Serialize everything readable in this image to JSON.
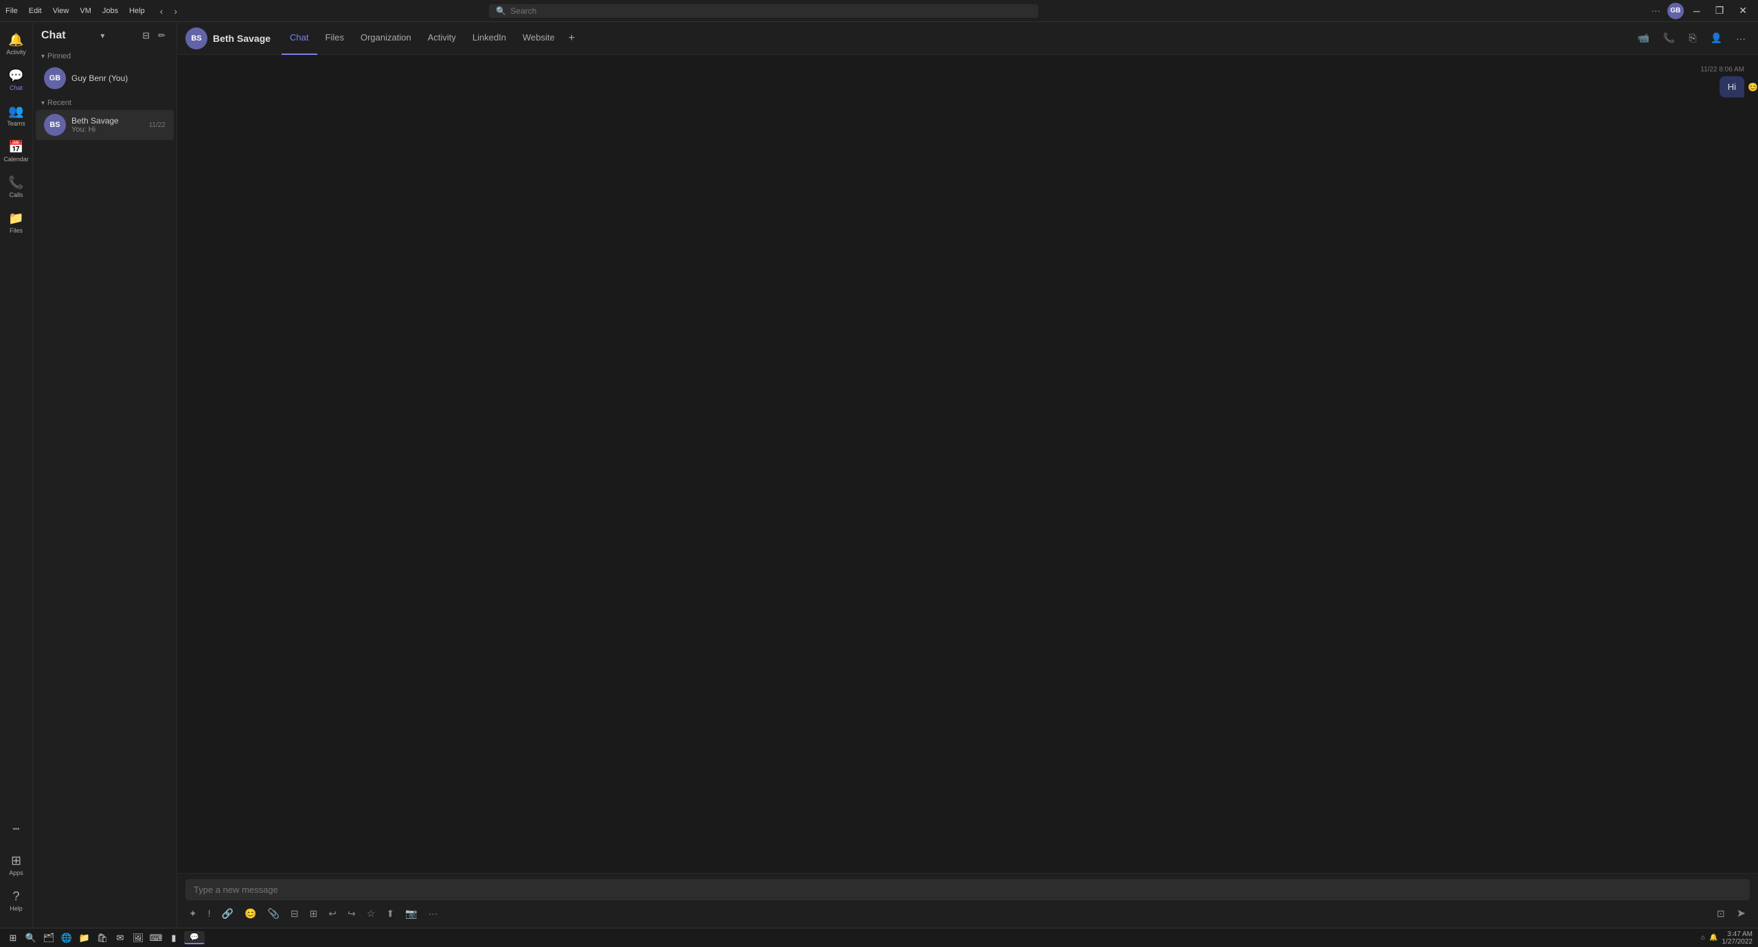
{
  "titlebar": {
    "menu_items": [
      "File",
      "Edit",
      "View",
      "VM",
      "Jobs",
      "Help"
    ],
    "search_placeholder": "Search",
    "nav_back": "‹",
    "nav_forward": "›",
    "user_initials": "GB",
    "win_minimize": "─",
    "win_restore": "❐",
    "win_close": "✕",
    "more_options": "···"
  },
  "left_rail": {
    "items": [
      {
        "id": "activity",
        "icon": "🔔",
        "label": "Activity"
      },
      {
        "id": "chat",
        "icon": "💬",
        "label": "Chat"
      },
      {
        "id": "teams",
        "icon": "👥",
        "label": "Teams"
      },
      {
        "id": "calendar",
        "icon": "📅",
        "label": "Calendar"
      },
      {
        "id": "calls",
        "icon": "📞",
        "label": "Calls"
      },
      {
        "id": "files",
        "icon": "📁",
        "label": "Files"
      }
    ],
    "more_label": "•••",
    "apps_label": "Apps",
    "help_label": "Help"
  },
  "sidebar": {
    "title": "Chat",
    "title_chevron": "▾",
    "filter_icon": "⊟",
    "compose_icon": "✏",
    "sections": {
      "pinned_label": "Pinned",
      "recent_label": "Recent"
    },
    "pinned_chats": [
      {
        "id": "guy-benr",
        "name": "Guy Benr (You)",
        "initials": "GB",
        "avatar_color": "#6264a7",
        "preview": "",
        "date": ""
      }
    ],
    "recent_chats": [
      {
        "id": "beth-savage",
        "name": "Beth Savage",
        "initials": "BS",
        "avatar_color": "#6264a7",
        "preview": "You: Hi",
        "date": "11/22",
        "active": true
      }
    ]
  },
  "chat_header": {
    "contact_name": "Beth Savage",
    "contact_initials": "BS",
    "avatar_color": "#6264a7",
    "tabs": [
      {
        "id": "chat",
        "label": "Chat",
        "active": true
      },
      {
        "id": "files",
        "label": "Files",
        "active": false
      },
      {
        "id": "organization",
        "label": "Organization",
        "active": false
      },
      {
        "id": "activity",
        "label": "Activity",
        "active": false
      },
      {
        "id": "linkedin",
        "label": "LinkedIn",
        "active": false
      },
      {
        "id": "website",
        "label": "Website",
        "active": false
      }
    ],
    "add_tab": "+",
    "action_video": "📹",
    "action_audio": "📞",
    "action_share": "⎘",
    "action_people": "👤",
    "action_more": "···"
  },
  "messages": [
    {
      "id": "msg1",
      "sender": "you",
      "text": "Hi",
      "timestamp": "11/22 8:06 AM",
      "reaction_icon": "😊"
    }
  ],
  "composer": {
    "placeholder": "Type a new message",
    "toolbar_icons": [
      "✦",
      "!",
      "🔗",
      "😊",
      "📎",
      "⊟",
      "⊞",
      "↩",
      "↪",
      "☆",
      "⬆",
      "📷",
      "···"
    ],
    "format_icon": "⊡",
    "send_icon": "➤"
  },
  "taskbar": {
    "start_icon": "⊞",
    "search_icon": "🔍",
    "apps": [
      {
        "id": "explorer",
        "icon": "🗂",
        "label": ""
      },
      {
        "id": "browser",
        "icon": "🌐",
        "label": ""
      },
      {
        "id": "folder",
        "icon": "📁",
        "label": ""
      },
      {
        "id": "store",
        "icon": "🛍",
        "label": ""
      },
      {
        "id": "mail",
        "icon": "✉",
        "label": ""
      },
      {
        "id": "code",
        "icon": "⌨",
        "label": ""
      },
      {
        "id": "terminal",
        "icon": "▮",
        "label": ""
      },
      {
        "id": "teams",
        "icon": "💬",
        "label": "",
        "active": true
      }
    ],
    "systray": "⌂",
    "time": "3:47 AM",
    "date": "1/27/2022",
    "notification_icon": "🔔"
  }
}
